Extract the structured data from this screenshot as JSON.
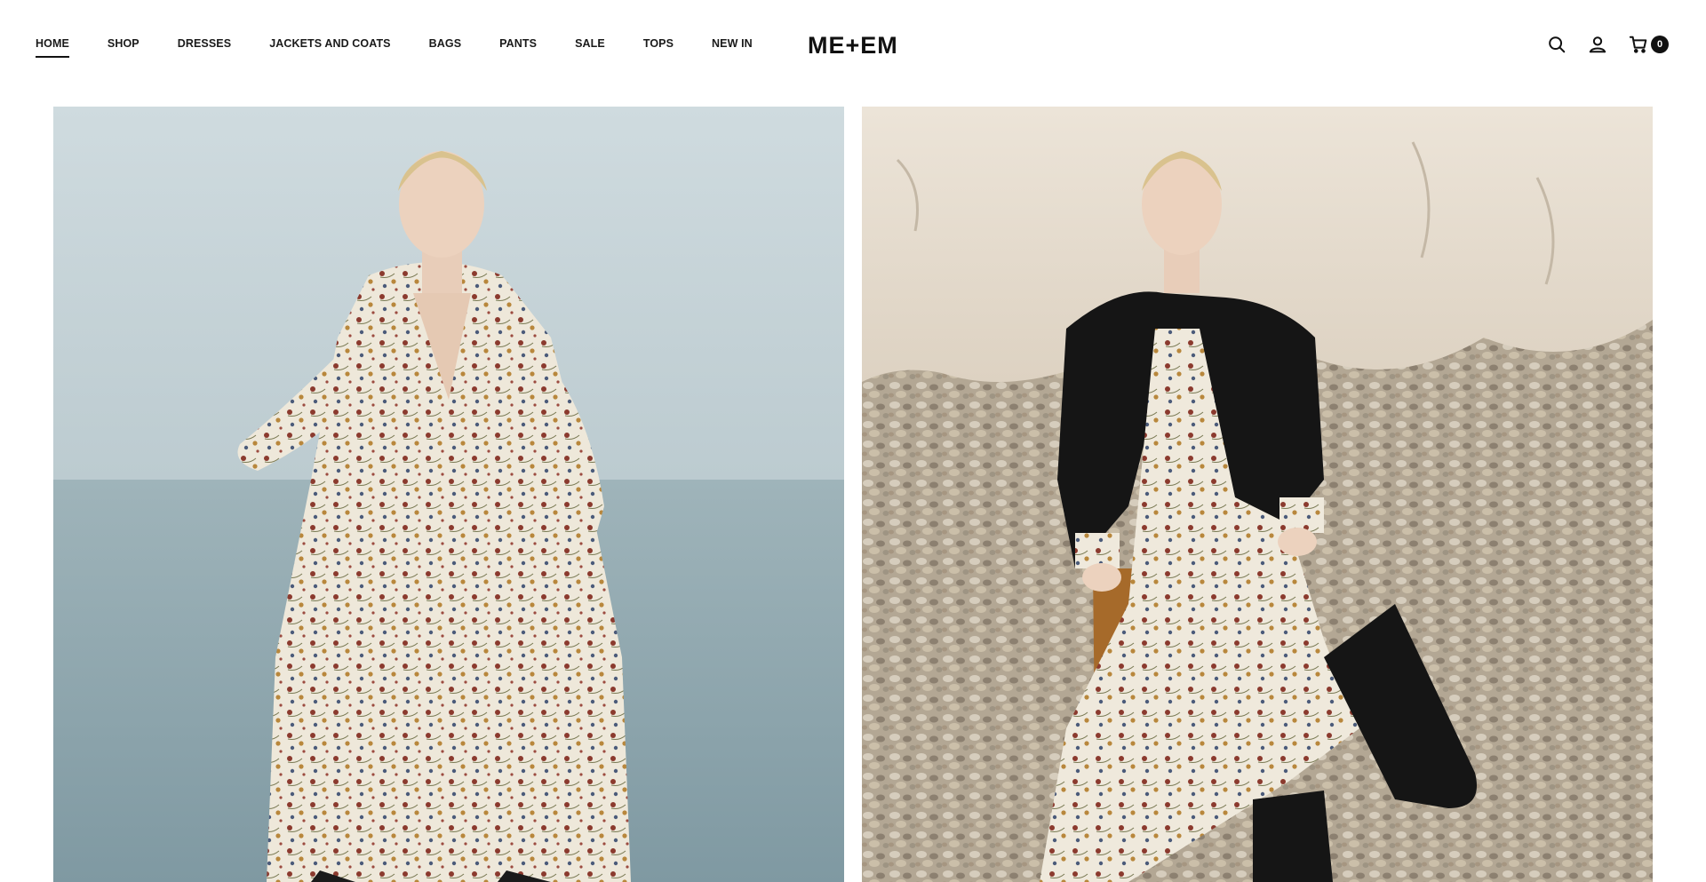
{
  "nav": {
    "items": [
      {
        "label": "HOME",
        "active": true
      },
      {
        "label": "SHOP",
        "active": false
      },
      {
        "label": "DRESSES",
        "active": false
      },
      {
        "label": "JACKETS AND COATS",
        "active": false
      },
      {
        "label": "BAGS",
        "active": false
      },
      {
        "label": "PANTS",
        "active": false
      },
      {
        "label": "SALE",
        "active": false
      },
      {
        "label": "TOPS",
        "active": false
      },
      {
        "label": "NEW IN",
        "active": false
      }
    ]
  },
  "brand": {
    "logo_text": "ME+EM"
  },
  "tools": {
    "search_icon": "search-icon",
    "account_icon": "user-icon",
    "cart_icon": "cart-icon",
    "cart_count": "0"
  },
  "hero": {
    "left_image": "model-sea-floral-dress",
    "right_image": "model-cliff-pebbles-floral-dress-black-blazer"
  },
  "colors": {
    "text": "#1a1a1a",
    "badge": "#111111",
    "sky": "#c9d6da",
    "sea": "#93a9b0",
    "cliff": "#e8ded0",
    "pebbles": "#b6aa98"
  }
}
